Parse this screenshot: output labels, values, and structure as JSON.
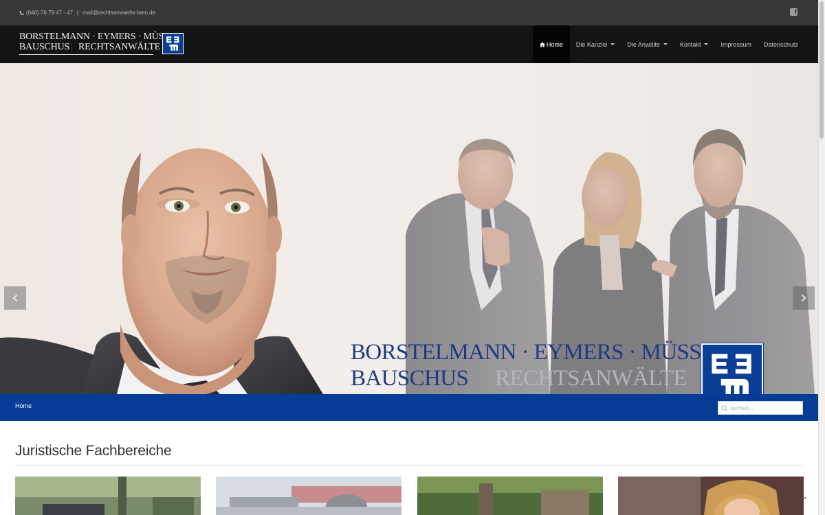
{
  "topbar": {
    "phone": "(040) 76 79 47 - 47",
    "separator": "|",
    "email": "mail@rechtsanwaelte-bem.de",
    "social_icon": "facebook-icon"
  },
  "logo": {
    "line1": "BORSTELMANN · EYMERS · MÜSSE",
    "line2_left": "BAUSCHUS",
    "line2_right": "RECHTSANWÄLTE"
  },
  "nav": {
    "items": [
      {
        "label": "Home",
        "active": true,
        "icon": "home-icon"
      },
      {
        "label": "Die Kanzlei",
        "dropdown": true
      },
      {
        "label": "Die Anwälte",
        "dropdown": true
      },
      {
        "label": "Kontakt",
        "dropdown": true
      },
      {
        "label": "Impressum"
      },
      {
        "label": "Datenschutz"
      }
    ]
  },
  "hero": {
    "logo_line1": "BORSTELMANN · EYMERS · MÜSSE",
    "logo_line2_left": "BAUSCHUS",
    "logo_line2_right": "RECHTSANWÄLTE",
    "prev_label": "‹",
    "next_label": "›"
  },
  "breadcrumb": {
    "home": "Home"
  },
  "search": {
    "placeholder": "suchen..."
  },
  "section": {
    "title": "Juristische Fachbereiche"
  },
  "colors": {
    "brand_blue": "#063b96",
    "topbar": "#383838",
    "navbar": "#141414"
  }
}
